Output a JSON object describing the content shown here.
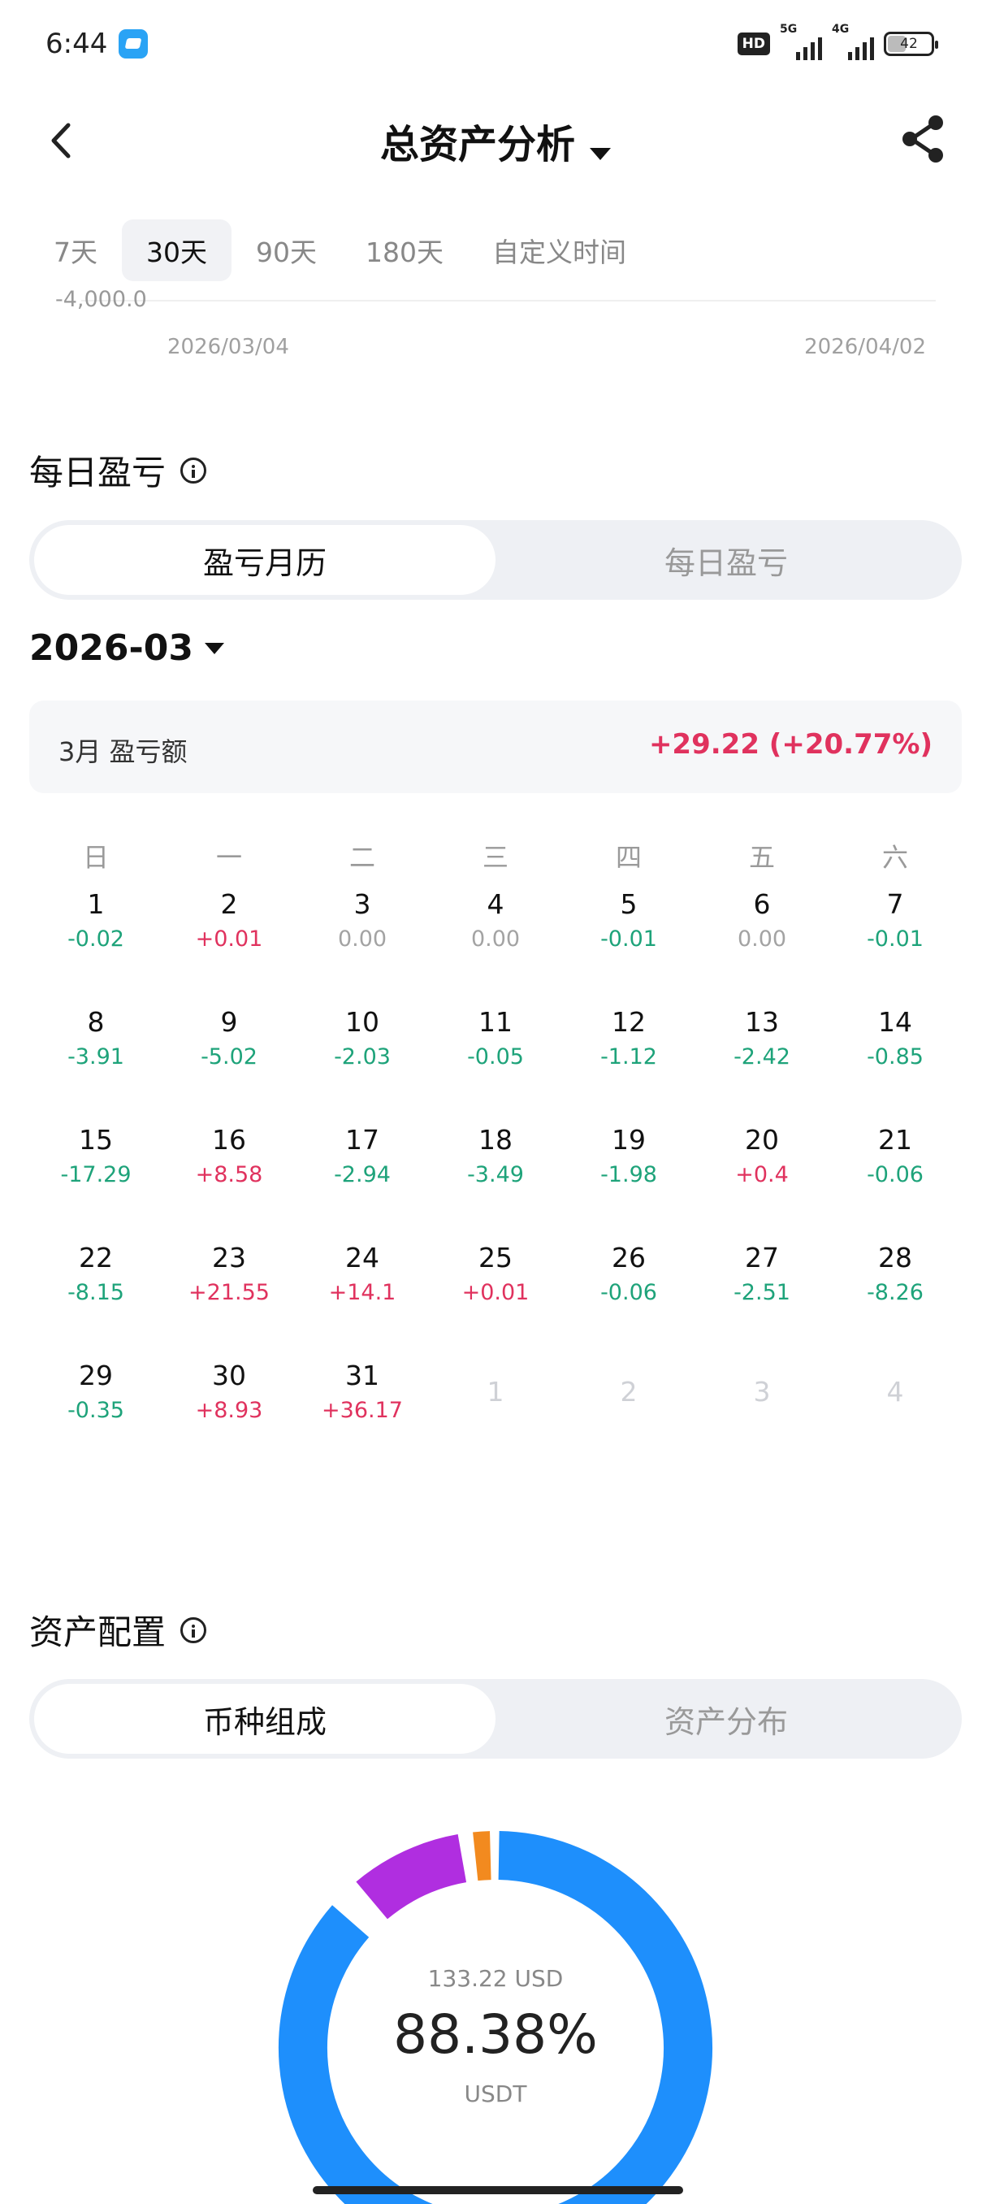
{
  "status_bar": {
    "time": "6:44",
    "hd": "HD",
    "net1": "5G",
    "net2": "4G",
    "battery": "42"
  },
  "header": {
    "title": "总资产分析"
  },
  "range_tabs": [
    "7天",
    "30天",
    "90天",
    "180天",
    "自定义时间"
  ],
  "active_range": "30天",
  "chart": {
    "y_tick": "-4,000.0",
    "date_start": "2026/03/04",
    "date_end": "2026/04/02"
  },
  "daily_pnl": {
    "title": "每日盈亏",
    "segment": [
      "盈亏月历",
      "每日盈亏"
    ],
    "month": "2026-03",
    "summary_label": "3月 盈亏额",
    "summary_value": "+29.22 (+20.77%)",
    "weekdays": [
      "日",
      "一",
      "二",
      "三",
      "四",
      "五",
      "六"
    ],
    "weeks": [
      [
        {
          "d": "1",
          "v": "-0.02"
        },
        {
          "d": "2",
          "v": "+0.01"
        },
        {
          "d": "3",
          "v": "0.00"
        },
        {
          "d": "4",
          "v": "0.00"
        },
        {
          "d": "5",
          "v": "-0.01"
        },
        {
          "d": "6",
          "v": "0.00"
        },
        {
          "d": "7",
          "v": "-0.01"
        }
      ],
      [
        {
          "d": "8",
          "v": "-3.91"
        },
        {
          "d": "9",
          "v": "-5.02"
        },
        {
          "d": "10",
          "v": "-2.03"
        },
        {
          "d": "11",
          "v": "-0.05"
        },
        {
          "d": "12",
          "v": "-1.12"
        },
        {
          "d": "13",
          "v": "-2.42"
        },
        {
          "d": "14",
          "v": "-0.85"
        }
      ],
      [
        {
          "d": "15",
          "v": "-17.29"
        },
        {
          "d": "16",
          "v": "+8.58"
        },
        {
          "d": "17",
          "v": "-2.94"
        },
        {
          "d": "18",
          "v": "-3.49"
        },
        {
          "d": "19",
          "v": "-1.98"
        },
        {
          "d": "20",
          "v": "+0.4"
        },
        {
          "d": "21",
          "v": "-0.06"
        }
      ],
      [
        {
          "d": "22",
          "v": "-8.15"
        },
        {
          "d": "23",
          "v": "+21.55"
        },
        {
          "d": "24",
          "v": "+14.1"
        },
        {
          "d": "25",
          "v": "+0.01"
        },
        {
          "d": "26",
          "v": "-0.06"
        },
        {
          "d": "27",
          "v": "-2.51"
        },
        {
          "d": "28",
          "v": "-8.26"
        }
      ],
      [
        {
          "d": "29",
          "v": "-0.35"
        },
        {
          "d": "30",
          "v": "+8.93"
        },
        {
          "d": "31",
          "v": "+36.17"
        },
        {
          "d": "1",
          "v": "",
          "other": true
        },
        {
          "d": "2",
          "v": "",
          "other": true
        },
        {
          "d": "3",
          "v": "",
          "other": true
        },
        {
          "d": "4",
          "v": "",
          "other": true
        }
      ]
    ]
  },
  "allocation": {
    "title": "资产配置",
    "segment": [
      "币种组成",
      "资产分布"
    ],
    "center_usd": "133.22 USD",
    "center_pct": "88.38%",
    "center_coin": "USDT",
    "colors": {
      "usdt": "#1e8ffc",
      "purple": "#b02ee0",
      "orange": "#f28a1f"
    },
    "share_usdt_pct": 88.38
  }
}
